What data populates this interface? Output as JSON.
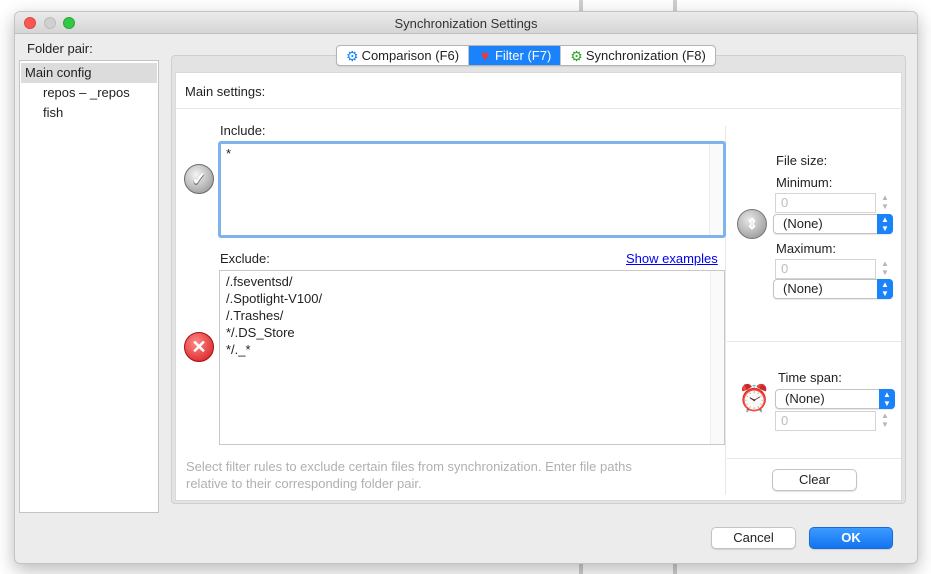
{
  "window": {
    "title": "Synchronization Settings"
  },
  "folder_pair": {
    "label": "Folder pair:",
    "items": [
      {
        "label": "Main config",
        "selected": true
      },
      {
        "label": "repos – _repos",
        "selected": false
      },
      {
        "label": "fish",
        "selected": false
      }
    ]
  },
  "tabs": [
    {
      "label": "Comparison (F6)",
      "icon": "gear-icon-blue",
      "active": false
    },
    {
      "label": "Filter (F7)",
      "icon": "filter-icon",
      "active": true
    },
    {
      "label": "Synchronization (F8)",
      "icon": "gear-icon-green",
      "active": false
    }
  ],
  "main_settings": {
    "label": "Main settings:"
  },
  "include": {
    "label": "Include:",
    "value": "*"
  },
  "exclude": {
    "label": "Exclude:",
    "show_examples": "Show examples",
    "lines": [
      "/.fseventsd/",
      "/.Spotlight-V100/",
      "/.Trashes/",
      "*/.DS_Store",
      "*/._*"
    ]
  },
  "hint": "Select filter rules to exclude certain files from synchronization. Enter file paths relative to their corresponding folder pair.",
  "file_size": {
    "label": "File size:",
    "minimum_label": "Minimum:",
    "minimum_value": "0",
    "minimum_unit": "(None)",
    "maximum_label": "Maximum:",
    "maximum_value": "0",
    "maximum_unit": "(None)"
  },
  "time_span": {
    "label": "Time span:",
    "value": "(None)",
    "number": "0"
  },
  "buttons": {
    "clear": "Clear",
    "cancel": "Cancel",
    "ok": "OK"
  },
  "colors": {
    "accent": "#1a82fb",
    "focus_ring": "#7fb3ee",
    "link": "#0000ee"
  }
}
